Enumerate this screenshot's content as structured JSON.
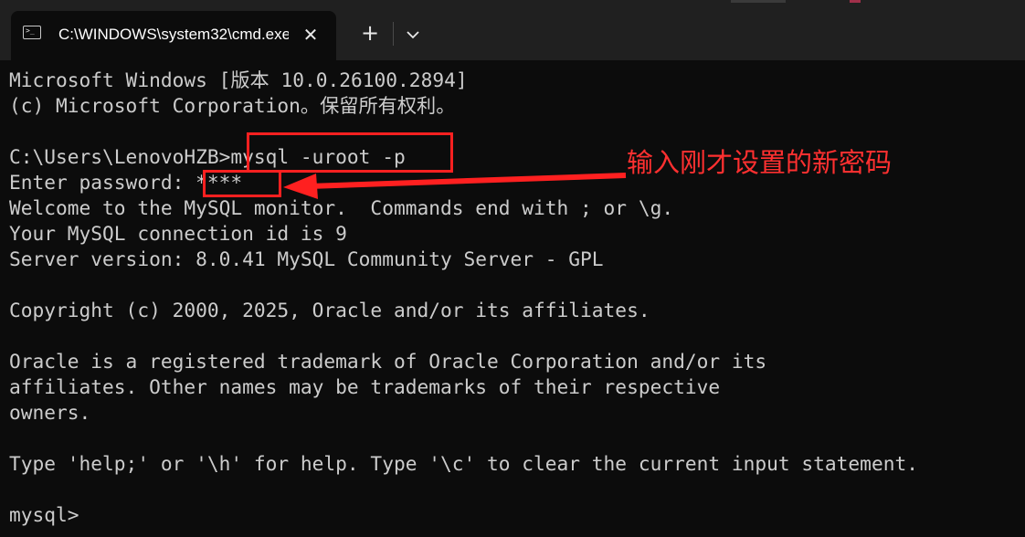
{
  "window": {
    "tab_title": "C:\\WINDOWS\\system32\\cmd.exe",
    "tab_icon": "cmd-icon",
    "close_icon": "close-icon",
    "new_tab_label": "+",
    "dropdown_icon": "chevron-down-icon"
  },
  "console": {
    "lines": [
      "Microsoft Windows [版本 10.0.26100.2894]",
      "(c) Microsoft Corporation。保留所有权利。",
      "",
      "C:\\Users\\LenovoHZB>mysql -uroot -p",
      "Enter password: ****",
      "Welcome to the MySQL monitor.  Commands end with ; or \\g.",
      "Your MySQL connection id is 9",
      "Server version: 8.0.41 MySQL Community Server - GPL",
      "",
      "Copyright (c) 2000, 2025, Oracle and/or its affiliates.",
      "",
      "Oracle is a registered trademark of Oracle Corporation and/or its",
      "affiliates. Other names may be trademarks of their respective",
      "owners.",
      "",
      "Type 'help;' or '\\h' for help. Type '\\c' to clear the current input statement.",
      "",
      "mysql>"
    ]
  },
  "annotation": {
    "text": "输入刚才设置的新密码",
    "color": "#ff2020"
  },
  "colors": {
    "background": "#0c0c0c",
    "titlebar": "#202020",
    "text": "#cccccc"
  }
}
